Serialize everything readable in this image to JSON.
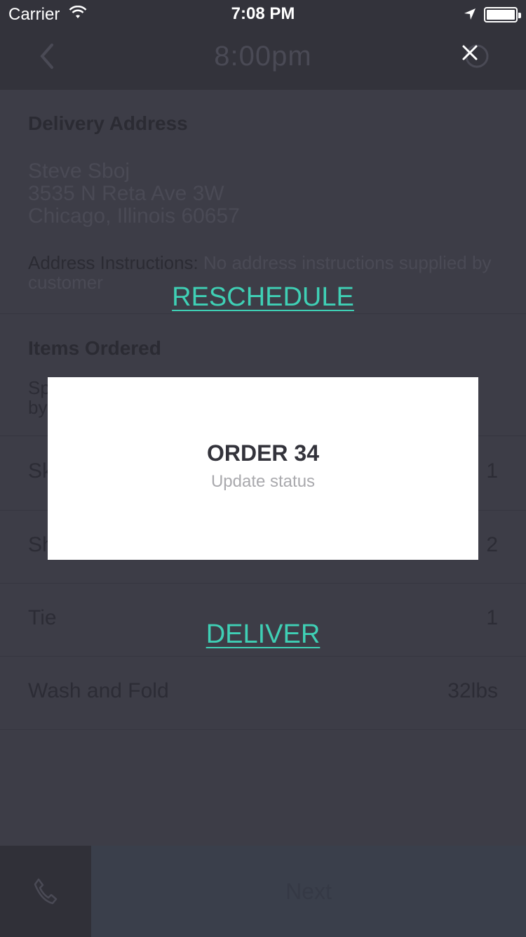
{
  "status_bar": {
    "carrier": "Carrier",
    "time": "7:08 PM"
  },
  "nav": {
    "title": "8:00pm"
  },
  "address": {
    "heading": "Delivery Address",
    "name": "Steve Sboj",
    "street": "3535 N Reta Ave 3W",
    "city": "Chicago, Illinois 60657",
    "instructions_label": "Address Instructions:",
    "instructions_value": " No address instructions supplied by customer"
  },
  "items": {
    "heading": "Items Ordered",
    "special_prefix": "Sp",
    "special_prefix_line2": "by",
    "rows": [
      {
        "name": "Sk",
        "qty": "1"
      },
      {
        "name": "Sh",
        "qty": "2"
      },
      {
        "name": "Tie",
        "qty": "1"
      },
      {
        "name": "Wash and Fold",
        "qty": "32lbs"
      }
    ]
  },
  "footer": {
    "next_label": "Next"
  },
  "actions": {
    "reschedule": "RESCHEDULE",
    "deliver": "DELIVER"
  },
  "modal": {
    "title": "ORDER 34",
    "subtitle": "Update status"
  },
  "colors": {
    "accent": "#3fd0b5",
    "background": "#3d3d47",
    "header": "#33333b"
  }
}
